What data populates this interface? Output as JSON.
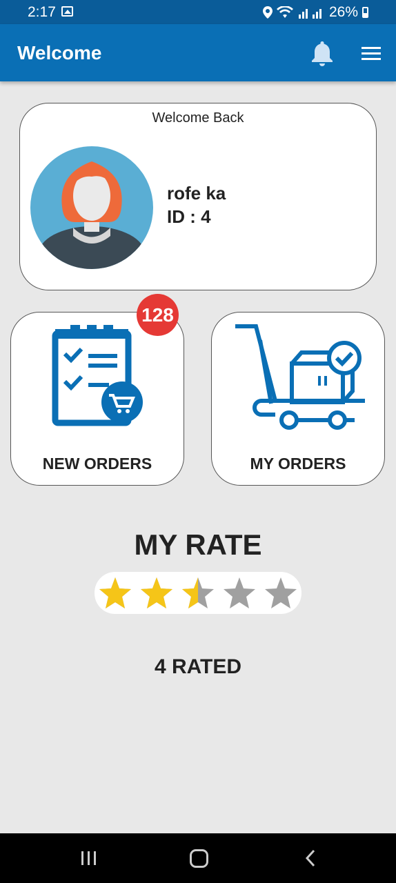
{
  "status_bar": {
    "time": "2:17",
    "battery": "26%"
  },
  "app_bar": {
    "title": "Welcome",
    "bell_icon": "bell-icon",
    "menu_icon": "hamburger-menu-icon"
  },
  "profile": {
    "greeting": "Welcome Back",
    "name": "rofe ka",
    "id_text": "ID : 4"
  },
  "tiles": {
    "new_orders": {
      "label": "NEW ORDERS",
      "badge": "128",
      "icon": "clipboard-cart-icon"
    },
    "my_orders": {
      "label": "MY ORDERS",
      "icon": "cart-checked-box-icon"
    }
  },
  "rating": {
    "title": "MY RATE",
    "value": 2.5,
    "max": 5,
    "count_text": "4 RATED"
  },
  "colors": {
    "primary": "#0a6fb5",
    "status_bar": "#0a5c99",
    "star_filled": "#f5c518",
    "star_empty": "#a0a0a0",
    "badge": "#e53935",
    "icon_blue": "#0a6fb5"
  }
}
